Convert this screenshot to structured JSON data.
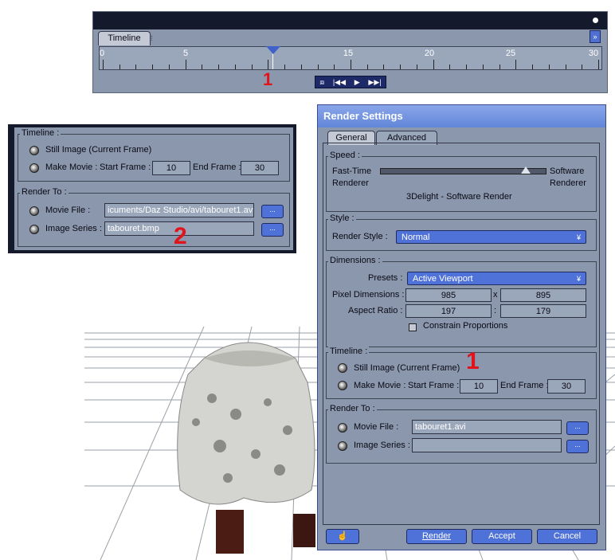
{
  "timeline_panel": {
    "tab_label": "Timeline",
    "tick_labels": [
      "0",
      "5",
      "15",
      "20",
      "25",
      "30"
    ],
    "annotation": "1"
  },
  "zoom_panel": {
    "timeline_group": "Timeline :",
    "still_image": "Still Image (Current Frame)",
    "make_movie": "Make Movie :",
    "start_frame_label": "Start Frame :",
    "start_frame_value": "10",
    "end_frame_label": "End Frame :",
    "end_frame_value": "30",
    "render_to_group": "Render To :",
    "movie_file_label": "Movie File :",
    "movie_file_value": "icuments/Daz Studio/avi/tabouret1.avi",
    "image_series_label": "Image Series :",
    "image_series_value": "tabouret.bmp",
    "dots": "...",
    "annotation": "2"
  },
  "render_settings": {
    "title": "Render Settings",
    "tabs": [
      "General",
      "Advanced"
    ],
    "speed_group": "Speed :",
    "speed_left": [
      "Fast-Time",
      "Renderer"
    ],
    "speed_right": [
      "Software",
      "Renderer"
    ],
    "renderer_name": "3Delight - Software Render",
    "style_group": "Style :",
    "render_style_label": "Render Style :",
    "render_style_value": "Normal",
    "dimensions_group": "Dimensions :",
    "presets_label": "Presets :",
    "presets_value": "Active Viewport",
    "pixel_dim_label": "Pixel Dimensions :",
    "pixel_w": "985",
    "pixel_x": "x",
    "pixel_h": "895",
    "aspect_label": "Aspect Ratio :",
    "aspect_w": "197",
    "aspect_colon": ":",
    "aspect_h": "179",
    "constrain_label": "Constrain Proportions",
    "timeline_group": "Timeline :",
    "still_image": "Still Image (Current Frame)",
    "make_movie": "Make Movie :",
    "start_frame_label": "Start Frame :",
    "start_frame_value": "10",
    "end_frame_label": "End Frame :",
    "end_frame_value": "30",
    "annotation": "1",
    "render_to_group": "Render To :",
    "movie_file_label": "Movie File :",
    "movie_file_value": "tabouret1.avi",
    "image_series_label": "Image Series :",
    "image_series_value": "",
    "dots": "...",
    "buttons": {
      "render": "Render",
      "accept": "Accept",
      "cancel": "Cancel"
    }
  },
  "colors": {
    "panel": "#8a97ac",
    "accent": "#4f72d8",
    "title_bar": "#6186d8",
    "annotation": "#e0141a"
  }
}
